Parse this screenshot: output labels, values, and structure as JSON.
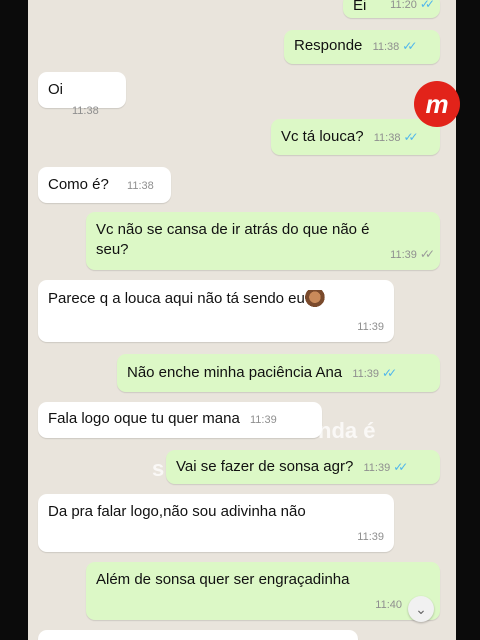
{
  "messages": [
    {
      "text": "Ei",
      "time": "11:20",
      "dir": "out",
      "status": "read"
    },
    {
      "text": "Responde",
      "time": "11:38",
      "dir": "out",
      "status": "read"
    },
    {
      "text": "Oi",
      "time": "11:38",
      "dir": "in"
    },
    {
      "text": "Vc tá louca?",
      "time": "11:38",
      "dir": "out",
      "status": "read"
    },
    {
      "text": "Como é?",
      "time": "11:38",
      "dir": "in"
    },
    {
      "text": "Vc não se cansa de ir atrás do que não é seu?",
      "time": "11:39",
      "dir": "out",
      "status": "delivered"
    },
    {
      "text": "Parece q a louca aqui não tá sendo eu",
      "time": "11:39",
      "dir": "in",
      "emoji": "woman-tipping-hand"
    },
    {
      "text": "Não enche minha paciência Ana",
      "time": "11:39",
      "dir": "out",
      "status": "read"
    },
    {
      "text": "Fala logo oque tu quer mana",
      "time": "11:39",
      "dir": "in"
    },
    {
      "text": "Vai se fazer de sonsa agr?",
      "time": "11:39",
      "dir": "out",
      "status": "read"
    },
    {
      "text": "Da pra falar logo,não sou adivinha não",
      "time": "11:39",
      "dir": "in"
    },
    {
      "text": "Além de sonsa quer ser engraçadinha",
      "time": "11:40",
      "dir": "out"
    }
  ],
  "watermark": {
    "line1": "nda é",
    "line2": "s"
  },
  "logo": {
    "letter": "m",
    "color": "#e2231a"
  },
  "colors": {
    "incoming": "#ffffff",
    "outgoing": "#dcf8c6",
    "read_ticks": "#4fb6ec",
    "background": "#e9e4dc"
  },
  "icons": {
    "read": "double-check-icon",
    "scroll": "chevron-down-icon"
  }
}
